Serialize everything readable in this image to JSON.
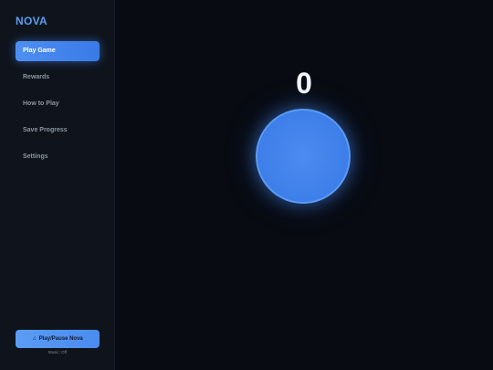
{
  "app": {
    "logo": "NOVA"
  },
  "sidebar": {
    "items": [
      {
        "label": "Play Game",
        "active": true
      },
      {
        "label": "Rewards",
        "active": false
      },
      {
        "label": "How to Play",
        "active": false
      },
      {
        "label": "Save Progress",
        "active": false
      },
      {
        "label": "Settings",
        "active": false
      }
    ],
    "music_button": {
      "icon": "music-note-icon",
      "glyph": "♫",
      "label": "Play/Pause Nova"
    },
    "music_status": "Music: Off"
  },
  "game": {
    "score": "0",
    "orb_color": "#3d7ee9"
  },
  "colors": {
    "accent": "#4e8ff2",
    "background": "#080b11",
    "sidebar_bg": "#0f141c",
    "logo": "#5a9ef2"
  }
}
